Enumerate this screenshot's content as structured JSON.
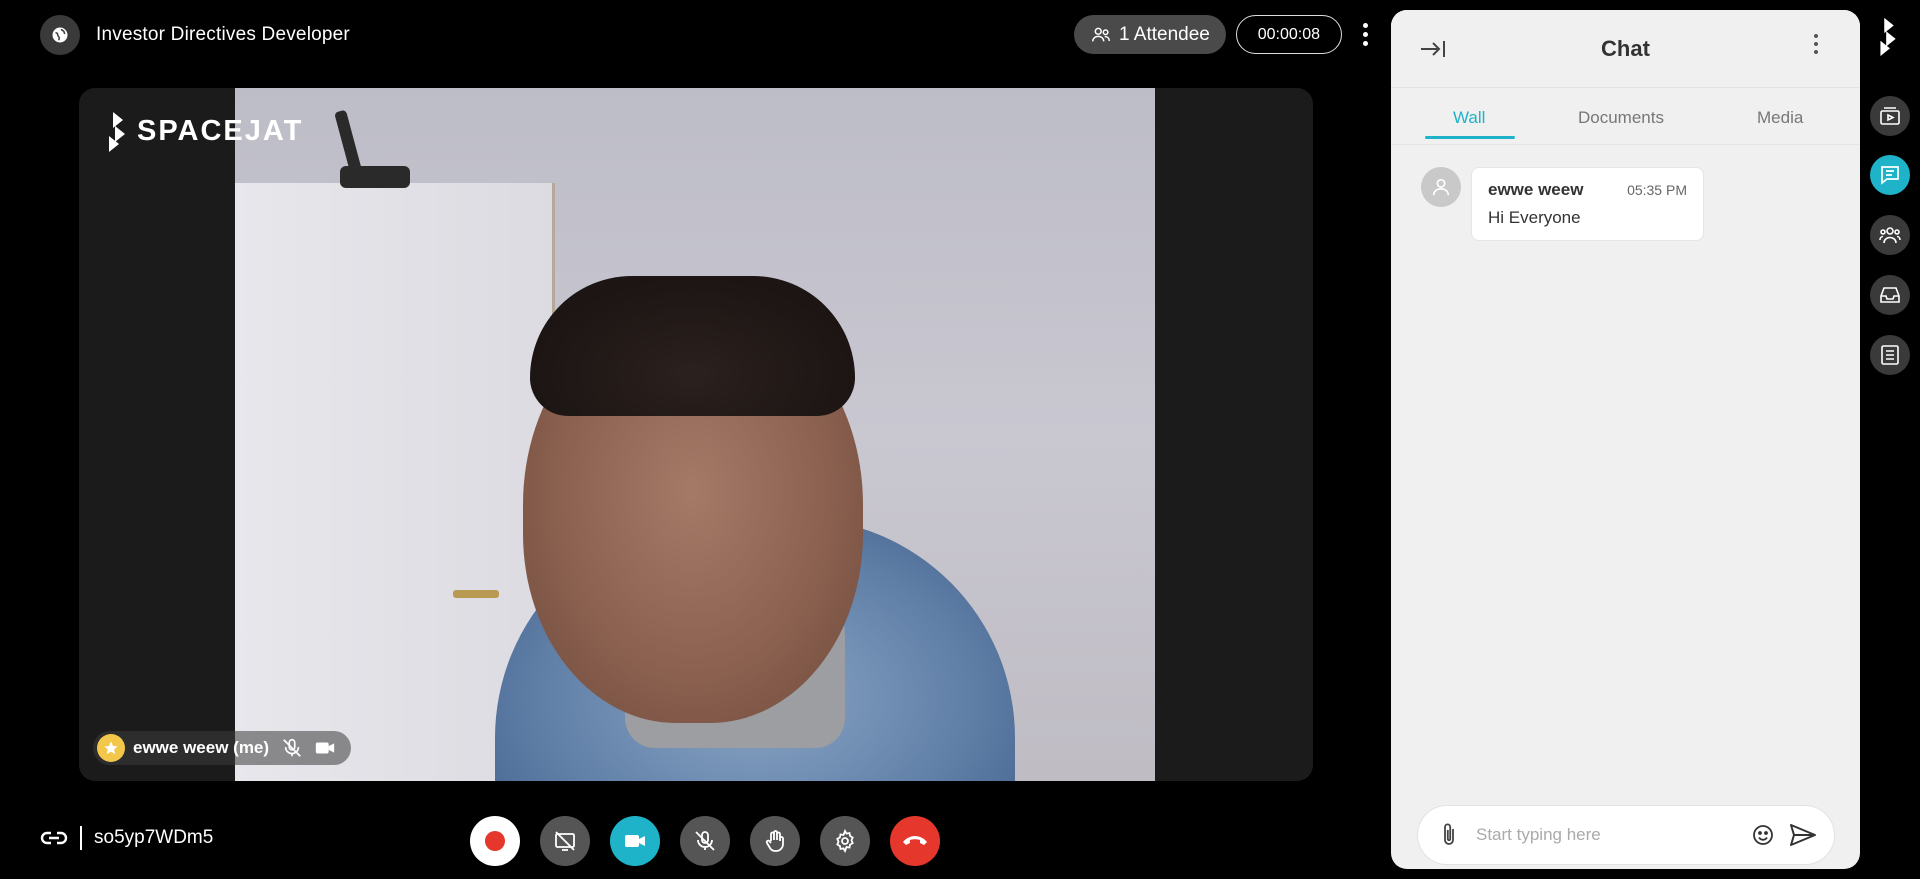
{
  "header": {
    "meeting_title": "Investor Directives Developer",
    "attendee_label": "1 Attendee",
    "timer": "00:00:08"
  },
  "video": {
    "brand_name": "SPACEJAT",
    "self_name": "ewwe weew (me)"
  },
  "footer": {
    "meeting_code": "so5yp7WDm5",
    "controls": [
      {
        "name": "record",
        "color": "#ffffff"
      },
      {
        "name": "screen-share-off",
        "color": "#555555"
      },
      {
        "name": "camera",
        "color": "#1fb3c9"
      },
      {
        "name": "mic-off",
        "color": "#555555"
      },
      {
        "name": "raise-hand",
        "color": "#555555"
      },
      {
        "name": "settings",
        "color": "#555555"
      },
      {
        "name": "end-call",
        "color": "#e5372b"
      }
    ]
  },
  "chat": {
    "title": "Chat",
    "tabs": [
      "Wall",
      "Documents",
      "Media"
    ],
    "active_tab": "Wall",
    "messages": [
      {
        "author": "ewwe weew",
        "time": "05:35 PM",
        "text": "Hi Everyone"
      }
    ],
    "composer_placeholder": "Start typing here"
  },
  "rail": {
    "items": [
      "playlist",
      "chat",
      "participants",
      "inbox",
      "notes"
    ],
    "active": "chat"
  },
  "colors": {
    "accent": "#1fb3c9",
    "danger": "#e5372b",
    "background": "#000000",
    "panel": "#f0f0f0"
  }
}
